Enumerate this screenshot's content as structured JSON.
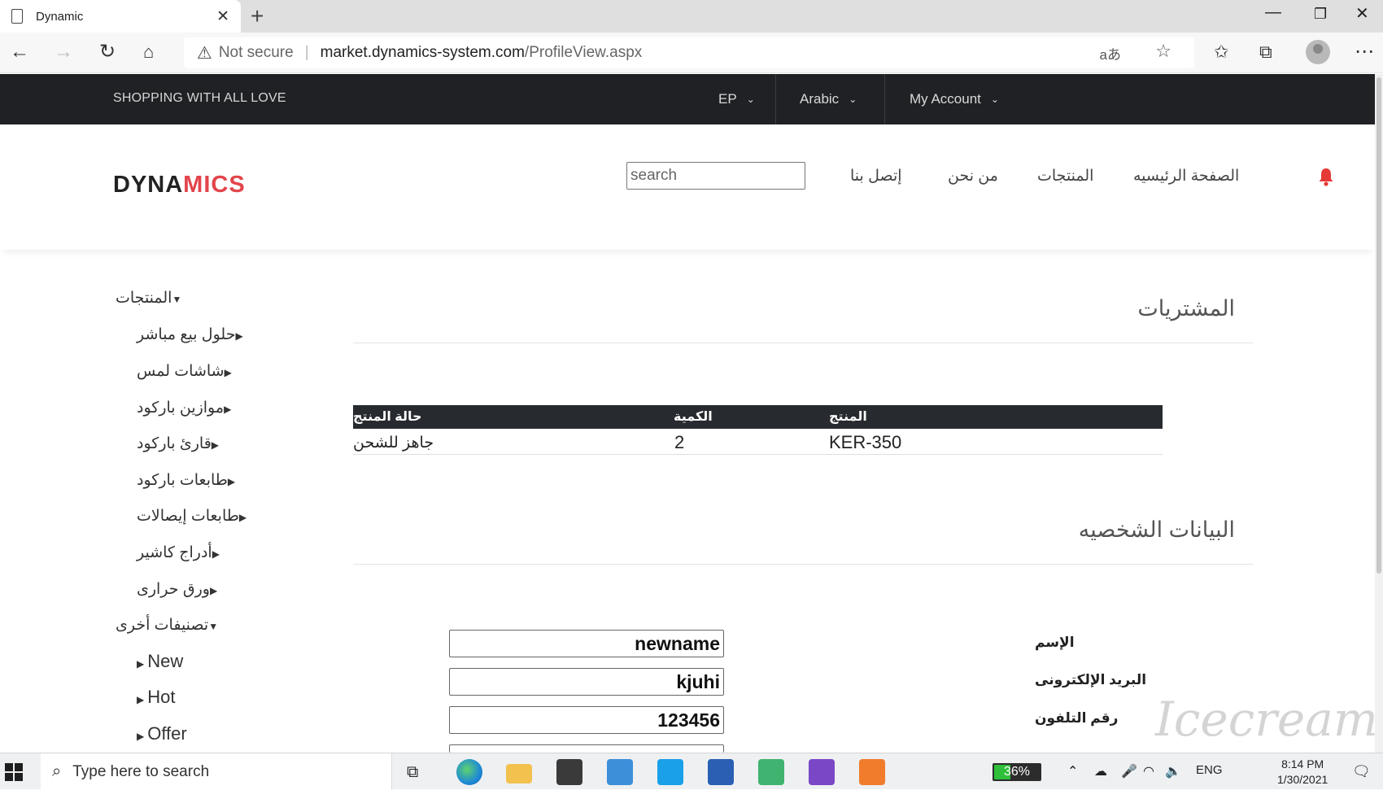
{
  "browser": {
    "tab_title": "Dynamic",
    "not_secure": "Not secure",
    "host": "market.dynamics-system.com",
    "path": "/ProfileView.aspx"
  },
  "topbar": {
    "slogan": "SHOPPING WITH ALL LOVE",
    "currency": "EP",
    "language": "Arabic",
    "account": "My Account"
  },
  "header": {
    "logo_part1": "DYNA",
    "logo_part2": "MICS",
    "logo_color": "#e2444b",
    "search_placeholder": "search",
    "nav": {
      "home": "الصفحة الرئيسيه",
      "products": "المنتجات",
      "about": "من نحن",
      "contact": "إتصل بنا"
    },
    "bell_color": "#e53935"
  },
  "sidebar": {
    "products_heading": "المنتجات",
    "product_items": [
      "حلول بيع مباشر",
      "شاشات لمس",
      "موازين باركود",
      "قارئ باركود",
      "طابعات باركود",
      "طابعات إيصالات",
      "أدراج كاشير",
      "ورق حرارى"
    ],
    "other_heading": "تصنيفات أخرى",
    "other_items": [
      "New",
      "Hot",
      "Offer"
    ]
  },
  "purchases": {
    "title": "المشتريات",
    "headers": {
      "product": "المنتج",
      "quantity": "الكمية",
      "status": "حالة المنتج"
    },
    "rows": [
      {
        "product": "KER-350",
        "quantity": "2",
        "status": "جاهز للشحن"
      }
    ]
  },
  "personal": {
    "title": "البيانات الشخصيه",
    "labels": {
      "name": "الإسم",
      "email": "البريد الإلكترونى",
      "phone": "رقم التلفون"
    },
    "values": {
      "name": "newname",
      "email": "kjuhi",
      "phone": "123456"
    }
  },
  "taskbar": {
    "search_placeholder": "Type here to search",
    "battery": "36%",
    "lang": "ENG",
    "time": "8:14 PM",
    "date": "1/30/2021"
  }
}
